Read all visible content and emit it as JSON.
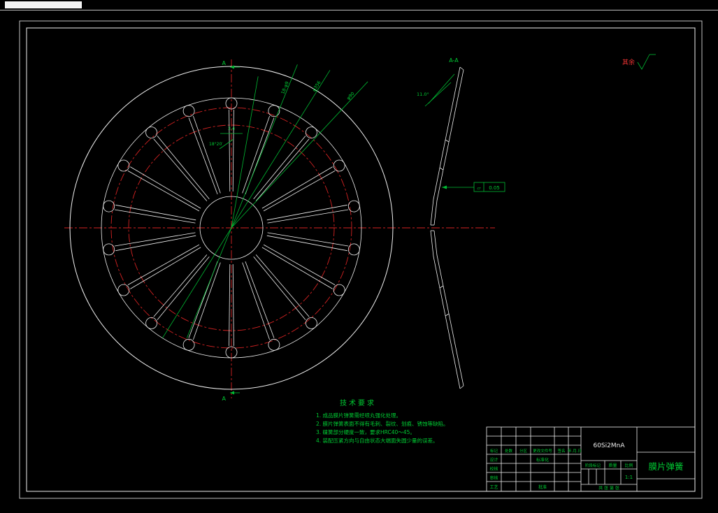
{
  "annotations": {
    "surface_note": "其余",
    "section_label": "A",
    "section_view_title": "A-A",
    "angle_dim": "11.0°",
    "flatness_symbol": "▱",
    "flatness_value": "0.05",
    "slot_width_dim": "3.4",
    "slot_angle_dim": "18°20′",
    "radial_dims": [
      "18-φ9",
      "φ356",
      "φ90"
    ]
  },
  "tech_requirements": {
    "title": "技术要求",
    "items": [
      "1. 成品膜片弹簧需经喷丸强化处理。",
      "2. 膜片弹簧表面不得有毛刺、裂纹、划痕、锈蚀等缺陷。",
      "3. 碟簧部分硬度一致，要求HRC40～45。",
      "4. 装配压紧方向与自由状态大端面失圆少量的误差。"
    ]
  },
  "title_block": {
    "material": "60Si2MnA",
    "part_name": "膜片弹簧",
    "stage_label": "阶段标记",
    "mass_label": "质量",
    "scale_label": "比例",
    "scale_value": "1:1",
    "header_row": [
      "标记",
      "处数",
      "分区",
      "更改文件号",
      "签名",
      "年.月.日"
    ],
    "row_labels": [
      "设计",
      "校核",
      "审核",
      "工艺"
    ],
    "row_labels_b": [
      "标准化",
      "批准"
    ],
    "sheet_info": "共 张 第 张"
  }
}
